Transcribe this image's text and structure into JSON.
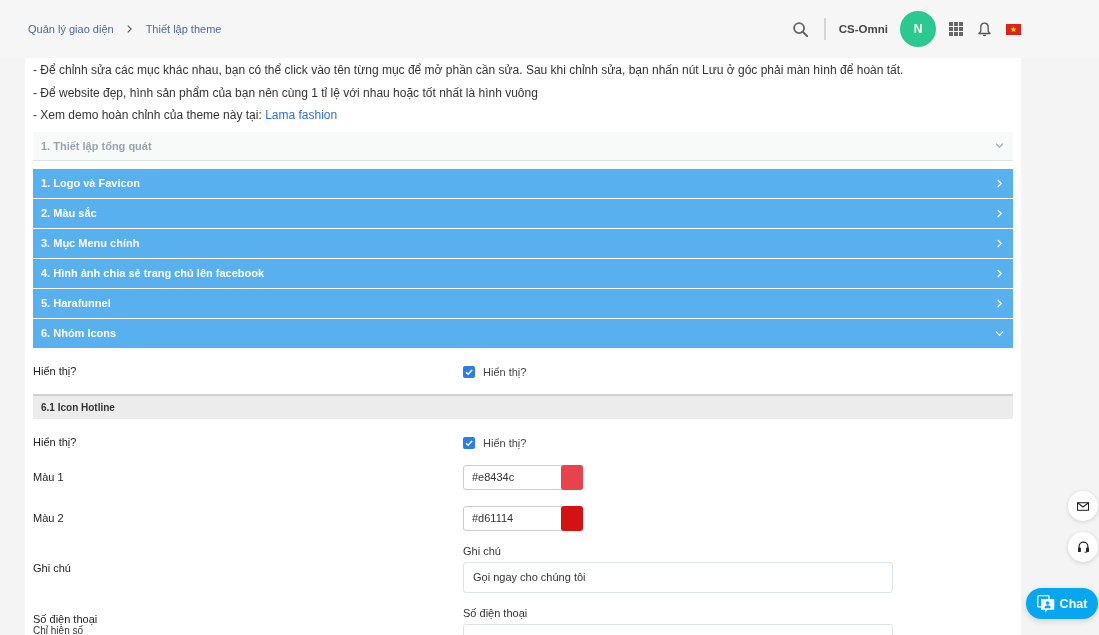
{
  "breadcrumb": [
    {
      "label": "Quản lý giao diện"
    },
    {
      "label": "Thiết lập theme"
    }
  ],
  "header": {
    "account": "CS-Omni",
    "avatar_initial": "N"
  },
  "notes": [
    {
      "text": "- Để chỉnh sửa các mục khác nhau, bạn có thể click vào tên từng mục để mở phần cần sửa. Sau khi chỉnh sửa, bạn nhấn nút Lưu ở góc phải màn hình để hoàn tất."
    },
    {
      "text": "- Để website đẹp, hình sản phẩm của bạn nên cùng 1 tỉ lệ với nhau hoặc tốt nhất là hình vuông"
    },
    {
      "text": "- Xem demo hoàn chỉnh của theme này tại:",
      "link": "Lama fashion"
    }
  ],
  "general_section": {
    "title": "1. Thiết lập tổng quát",
    "expanded": true
  },
  "sections": [
    {
      "title": "1. Logo và Favicon",
      "expanded": false
    },
    {
      "title": "2. Màu sắc",
      "expanded": false
    },
    {
      "title": "3. Mục Menu chính",
      "expanded": false
    },
    {
      "title": "4. Hình ảnh chia sẻ trang chủ lên facebook",
      "expanded": false
    },
    {
      "title": "5. Harafunnel",
      "expanded": false
    },
    {
      "title": "6. Nhóm Icons",
      "expanded": true,
      "fields": [
        {
          "kind": "checkbox",
          "label": "Hiển thị?",
          "option": "Hiển thị?",
          "checked": true
        }
      ],
      "subsections": [
        {
          "title": "6.1 Icon Hotline",
          "fields": [
            {
              "kind": "checkbox",
              "label": "Hiển thị?",
              "option": "Hiển thị?",
              "checked": true
            },
            {
              "kind": "color",
              "label": "Màu 1",
              "value": "#e8434c",
              "color": "#e8434c"
            },
            {
              "kind": "color",
              "label": "Màu 2",
              "value": "#d61114",
              "color": "#d61114"
            },
            {
              "kind": "text",
              "label": "Ghi chú",
              "caption": "Ghi chú",
              "value": "Gọi ngay cho chúng tôi"
            },
            {
              "kind": "text",
              "label": "Số điện thoại",
              "hint": "Chỉ hiện số",
              "caption": "Số điện thoại"
            }
          ]
        }
      ]
    }
  ],
  "floating": {
    "chat_label": "Chat"
  }
}
